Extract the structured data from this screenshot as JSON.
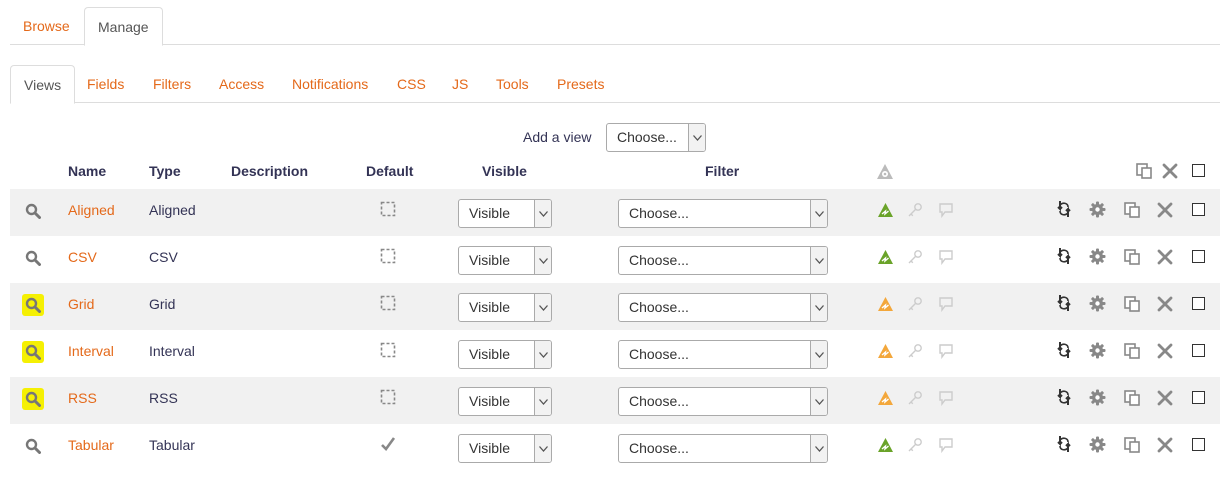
{
  "top_tabs": [
    {
      "label": "Browse",
      "active": false
    },
    {
      "label": "Manage",
      "active": true
    }
  ],
  "sub_tabs": [
    {
      "label": "Views",
      "active": true
    },
    {
      "label": "Fields",
      "active": false
    },
    {
      "label": "Filters",
      "active": false
    },
    {
      "label": "Access",
      "active": false
    },
    {
      "label": "Notifications",
      "active": false
    },
    {
      "label": "CSS",
      "active": false
    },
    {
      "label": "JS",
      "active": false
    },
    {
      "label": "Tools",
      "active": false
    },
    {
      "label": "Presets",
      "active": false
    }
  ],
  "add_view": {
    "label": "Add a view",
    "select_value": "Choose..."
  },
  "columns": {
    "name": "Name",
    "type": "Type",
    "description": "Description",
    "default": "Default",
    "visible": "Visible",
    "filter": "Filter"
  },
  "rows": [
    {
      "name": "Aligned",
      "type": "Aligned",
      "description": "",
      "is_default": false,
      "visible": "Visible",
      "filter": "Choose...",
      "highlighted": false,
      "status_color": "green"
    },
    {
      "name": "CSV",
      "type": "CSV",
      "description": "",
      "is_default": false,
      "visible": "Visible",
      "filter": "Choose...",
      "highlighted": false,
      "status_color": "green"
    },
    {
      "name": "Grid",
      "type": "Grid",
      "description": "",
      "is_default": false,
      "visible": "Visible",
      "filter": "Choose...",
      "highlighted": true,
      "status_color": "orange"
    },
    {
      "name": "Interval",
      "type": "Interval",
      "description": "",
      "is_default": false,
      "visible": "Visible",
      "filter": "Choose...",
      "highlighted": true,
      "status_color": "orange"
    },
    {
      "name": "RSS",
      "type": "RSS",
      "description": "",
      "is_default": false,
      "visible": "Visible",
      "filter": "Choose...",
      "highlighted": true,
      "status_color": "orange"
    },
    {
      "name": "Tabular",
      "type": "Tabular",
      "description": "",
      "is_default": true,
      "visible": "Visible",
      "filter": "Choose...",
      "highlighted": false,
      "status_color": "green"
    }
  ],
  "colors": {
    "link": "#e4691a",
    "status_green": "#6aa329",
    "status_orange": "#f3a73b",
    "status_gray": "#bbbbbb",
    "highlight": "#f5f003",
    "row_shade": "#f1f1f1"
  },
  "icons": {
    "row_actions": [
      "refresh-icon",
      "gear-icon",
      "duplicate-icon",
      "delete-icon"
    ],
    "row_status": [
      "status-triangle-icon",
      "key-icon",
      "comment-icon"
    ],
    "header": [
      "status-triangle-icon",
      "duplicate-icon",
      "delete-icon"
    ]
  }
}
